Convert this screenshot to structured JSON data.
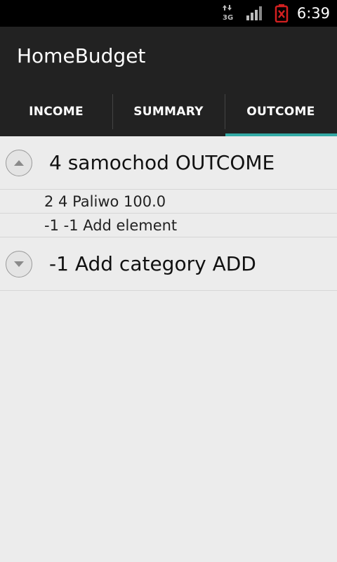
{
  "status_bar": {
    "time": "6:39",
    "icons": [
      "data-3g-icon",
      "signal-icon",
      "battery-alert-icon"
    ]
  },
  "app": {
    "title": "HomeBudget"
  },
  "tabs": [
    {
      "label": "INCOME",
      "active": false
    },
    {
      "label": "SUMMARY",
      "active": false
    },
    {
      "label": "OUTCOME",
      "active": true
    }
  ],
  "colors": {
    "tab_indicator": "#33aaa5",
    "action_bar": "#222222",
    "battery_alert": "#d32020"
  },
  "list": {
    "groups": [
      {
        "label": "4 samochod OUTCOME",
        "expanded": true,
        "children": [
          {
            "label": "2 4 Paliwo 100.0"
          },
          {
            "label": "-1 -1 Add element"
          }
        ]
      },
      {
        "label": "-1 Add category ADD",
        "expanded": false,
        "children": []
      }
    ]
  }
}
